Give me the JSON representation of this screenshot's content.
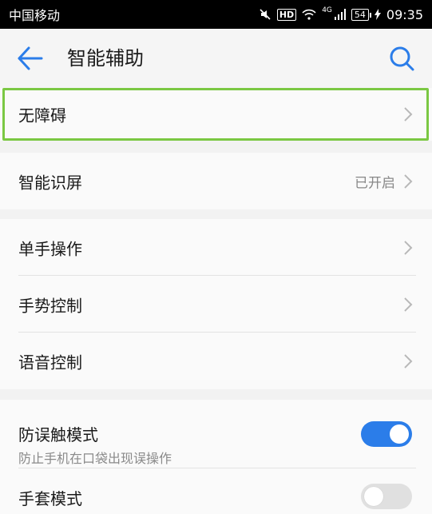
{
  "status_bar": {
    "carrier": "中国移动",
    "battery": "54",
    "time": "09:35",
    "network": "4G"
  },
  "header": {
    "title": "智能辅助"
  },
  "sections": [
    {
      "rows": [
        {
          "label": "无障碍"
        }
      ]
    },
    {
      "rows": [
        {
          "label": "智能识屏",
          "value": "已开启"
        }
      ]
    },
    {
      "rows": [
        {
          "label": "单手操作"
        },
        {
          "label": "手势控制"
        },
        {
          "label": "语音控制"
        }
      ]
    },
    {
      "rows": [
        {
          "label": "防误触模式",
          "sublabel": "防止手机在口袋出现误操作",
          "toggle": true
        },
        {
          "label": "手套模式",
          "toggle": false
        }
      ]
    }
  ],
  "colors": {
    "accent": "#2b7de9",
    "highlight": "#7bc843"
  }
}
